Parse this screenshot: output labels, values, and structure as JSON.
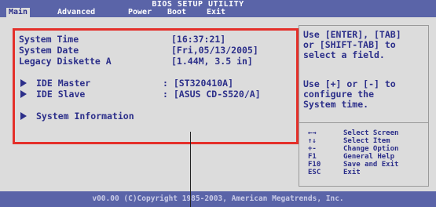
{
  "header": {
    "title_line1": "BIOS SETUP UTILITY",
    "tabs": [
      {
        "label": "Main"
      },
      {
        "label": "Advanced"
      },
      {
        "label": "Power"
      },
      {
        "label": "Boot"
      },
      {
        "label": "Exit"
      }
    ]
  },
  "main": {
    "fields": [
      {
        "label": "System Time",
        "value": "[16:37:21]"
      },
      {
        "label": "System Date",
        "value": "[Fri,05/13/2005]"
      },
      {
        "label": "Legacy Diskette A",
        "value": "[1.44M, 3.5 in]"
      }
    ],
    "submenus": [
      {
        "label": "IDE Master",
        "value": ": [ST320410A]"
      },
      {
        "label": "IDE Slave",
        "value": ": [ASUS CD-S520/A]"
      },
      {
        "label": "System Information",
        "value": ""
      }
    ]
  },
  "help": {
    "text1": "Use [ENTER], [TAB]\nor [SHIFT-TAB] to\nselect a field.",
    "text2": "Use [+] or [-] to\nconfigure the\nSystem time."
  },
  "keys": [
    {
      "key": "←→",
      "desc": "Select Screen"
    },
    {
      "key": "↑↓",
      "desc": "Select Item"
    },
    {
      "key": "+-",
      "desc": "Change Option"
    },
    {
      "key": "F1",
      "desc": "General Help"
    },
    {
      "key": "F10",
      "desc": "Save and Exit"
    },
    {
      "key": "ESC",
      "desc": "Exit"
    }
  ],
  "footer": {
    "copyright": "v00.00 (C)Copyright 1985-2003, American Megatrends, Inc."
  },
  "colors": {
    "header_bg": "#5a64a8",
    "body_bg": "#dcdcdc",
    "text": "#2c2f8a",
    "highlight_border": "#e4302a"
  }
}
